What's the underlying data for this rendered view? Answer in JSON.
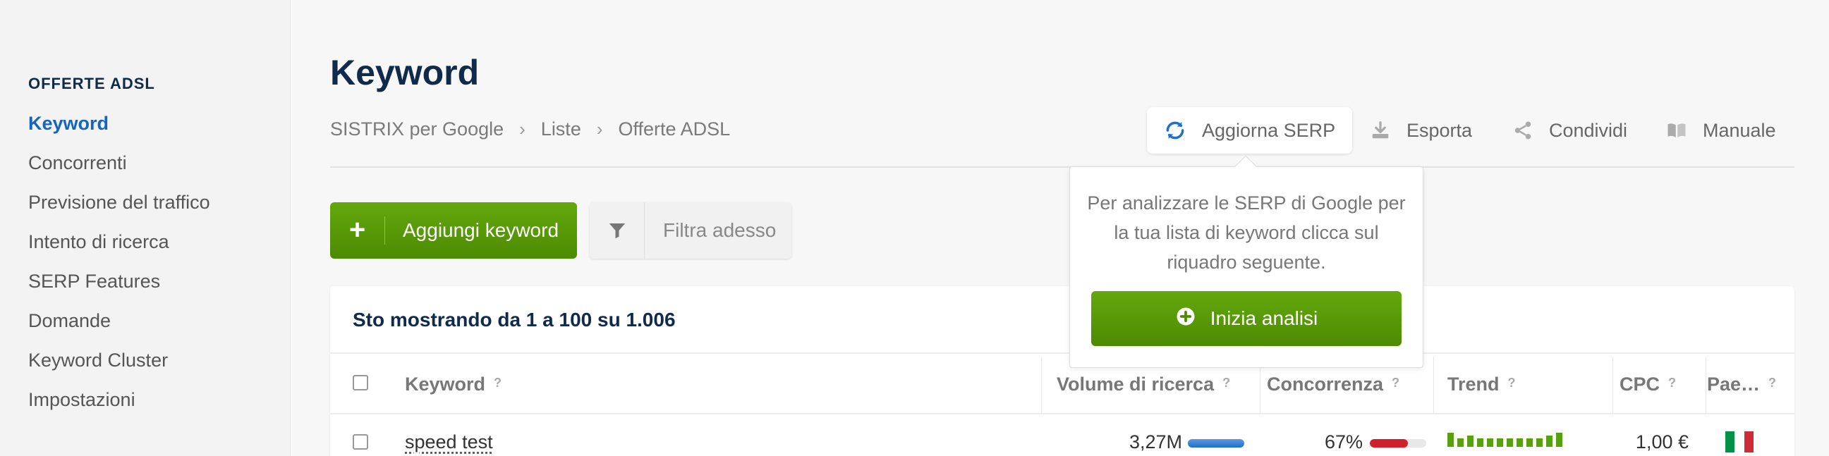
{
  "sidebar": {
    "section_title": "OFFERTE ADSL",
    "items": [
      {
        "label": "Keyword",
        "active": true
      },
      {
        "label": "Concorrenti"
      },
      {
        "label": "Previsione del traffico"
      },
      {
        "label": "Intento di ricerca"
      },
      {
        "label": "SERP Features"
      },
      {
        "label": "Domande"
      },
      {
        "label": "Keyword Cluster"
      },
      {
        "label": "Impostazioni"
      }
    ]
  },
  "header": {
    "title": "Keyword",
    "breadcrumb": [
      "SISTRIX per Google",
      "Liste",
      "Offerte ADSL"
    ],
    "breadcrumb_separator": "›"
  },
  "toolbar": {
    "refresh_label": "Aggiorna SERP",
    "export_label": "Esporta",
    "share_label": "Condividi",
    "manual_label": "Manuale"
  },
  "popover": {
    "text": "Per analizzare le SERP di Google per la tua lista di keyword clicca sul riquadro seguente.",
    "button_label": "Inizia analisi"
  },
  "actions": {
    "add_keyword_label": "Aggiungi keyword",
    "add_icon_glyph": "+",
    "filter_label": "Filtra adesso"
  },
  "table": {
    "summary": "Sto mostrando da 1 a 100 su 1.006",
    "help_glyph": "?",
    "headers": {
      "keyword": "Keyword",
      "volume": "Volume di ricerca",
      "competition": "Concorrenza",
      "trend": "Trend",
      "cpc": "CPC",
      "country": "Pae…"
    },
    "rows": [
      {
        "keyword": "speed test",
        "volume": "3,27M",
        "volume_fraction": 1.0,
        "competition": "67%",
        "competition_fraction": 0.67,
        "trend": [
          1.0,
          0.6,
          0.8,
          0.6,
          0.6,
          0.6,
          0.6,
          0.6,
          0.6,
          0.6,
          0.8,
          1.0
        ],
        "cpc": "1,00 €",
        "country_flag": "Italy"
      }
    ]
  },
  "colors": {
    "accent_blue": "#1565c0",
    "primary_green": "#5a9a0a",
    "navy": "#0f2a4a",
    "competition_red": "#d0202a",
    "trend_green": "#58a012",
    "flag_green": "#009246",
    "flag_white": "#ffffff",
    "flag_red": "#ce2b37"
  }
}
